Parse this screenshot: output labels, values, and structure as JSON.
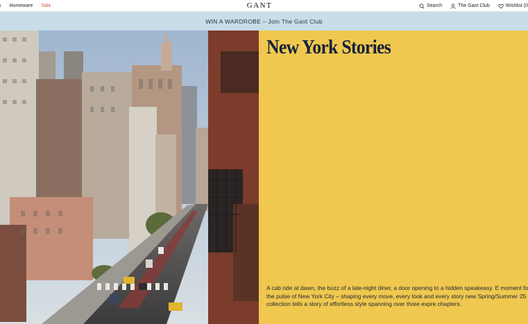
{
  "nav": {
    "left_links": [
      "s",
      "Homeware",
      "Sale"
    ],
    "logo_text": "GANT",
    "search_label": "Search",
    "club_label": "The Gant Club",
    "wishlist_label": "Wishlist (0"
  },
  "promo": {
    "text": "WIN A WARDROBE – Join The Gant Club"
  },
  "hero": {
    "title": "New York Stories",
    "body": "A cab ride at dawn, the buzz of a late-night diner, a door opening to a hidden speakeasy. E moment forms the pulse of New York City – shaping every move, every look and every story new Spring/Summer 25 collection tells a story of effortless style spanning over three expre chapters."
  },
  "colors": {
    "promo_bg": "#c8dde7",
    "panel_bg": "#f0c84f",
    "sale_text": "#d2503c"
  },
  "icons": {
    "search": "search-icon",
    "club": "user-icon",
    "wishlist": "heart-icon"
  }
}
